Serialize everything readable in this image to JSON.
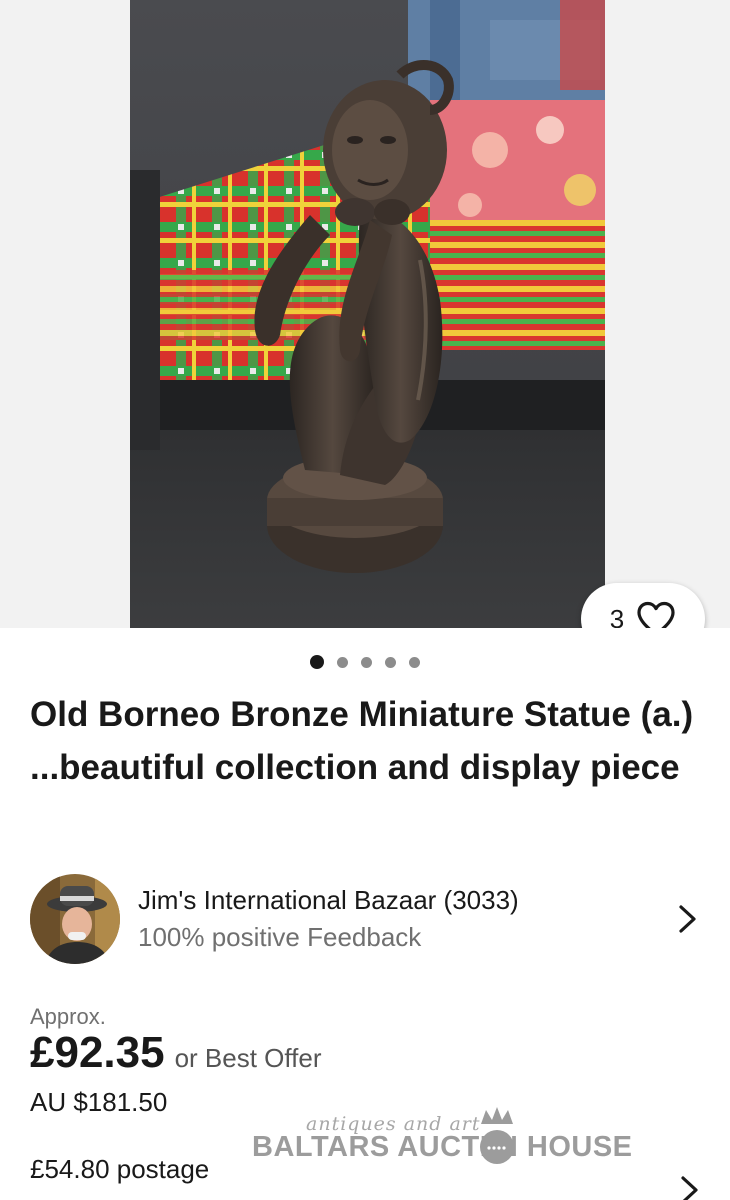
{
  "listing": {
    "title": "Old Borneo Bronze Miniature Statue (a.) ...beautiful collection and display piece",
    "image_count": 5,
    "active_image_index": 0,
    "watch_count": "3"
  },
  "icons": {
    "watch": "heart-outline-icon",
    "seller_link": "chevron-right-icon",
    "postage_link": "chevron-right-icon"
  },
  "seller": {
    "name": "Jim's International Bazaar (3033)",
    "feedback": "100% positive Feedback"
  },
  "price": {
    "approx_label": "Approx.",
    "amount": "£92.35",
    "offer_text": "or Best Offer",
    "converted": "AU $181.50"
  },
  "shipping": {
    "postage": "£54.80 postage"
  },
  "watermark": {
    "subtitle": "antiques and art",
    "name": "BALTARS AUCTI N HOUSE"
  },
  "colors": {
    "text_primary": "#191919",
    "text_secondary": "#707070",
    "gallery_bg": "#f2f2f2"
  }
}
